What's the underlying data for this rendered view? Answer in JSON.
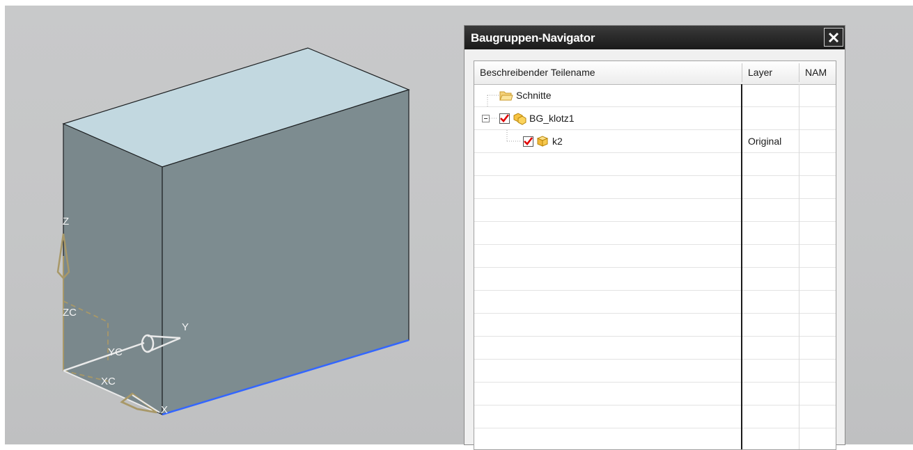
{
  "viewport": {
    "axis_labels": {
      "z": "Z",
      "zc": "ZC",
      "y": "Y",
      "yc": "YC",
      "xc": "XC",
      "x": "X"
    }
  },
  "navigator": {
    "title": "Baugruppen-Navigator",
    "close_icon": "close-icon",
    "columns": [
      "Beschreibender Teilename",
      "Layer",
      "NAM"
    ],
    "tree": [
      {
        "label": "Schnitte",
        "layer": "",
        "icon": "folder-icon"
      },
      {
        "label": "BG_klotz1",
        "layer": "",
        "icon": "assembly-icon",
        "checked": true,
        "expanded": true
      },
      {
        "label": "k2",
        "layer": "Original",
        "icon": "part-icon",
        "checked": true
      }
    ]
  },
  "colors": {
    "top_face": "#c2d8e0",
    "front_face": "#7c8b8f",
    "side_face": "#7d8c90",
    "highlight_edge": "#3366ff",
    "axis": "#b0a068",
    "titlebar": "#1a1a1a"
  }
}
